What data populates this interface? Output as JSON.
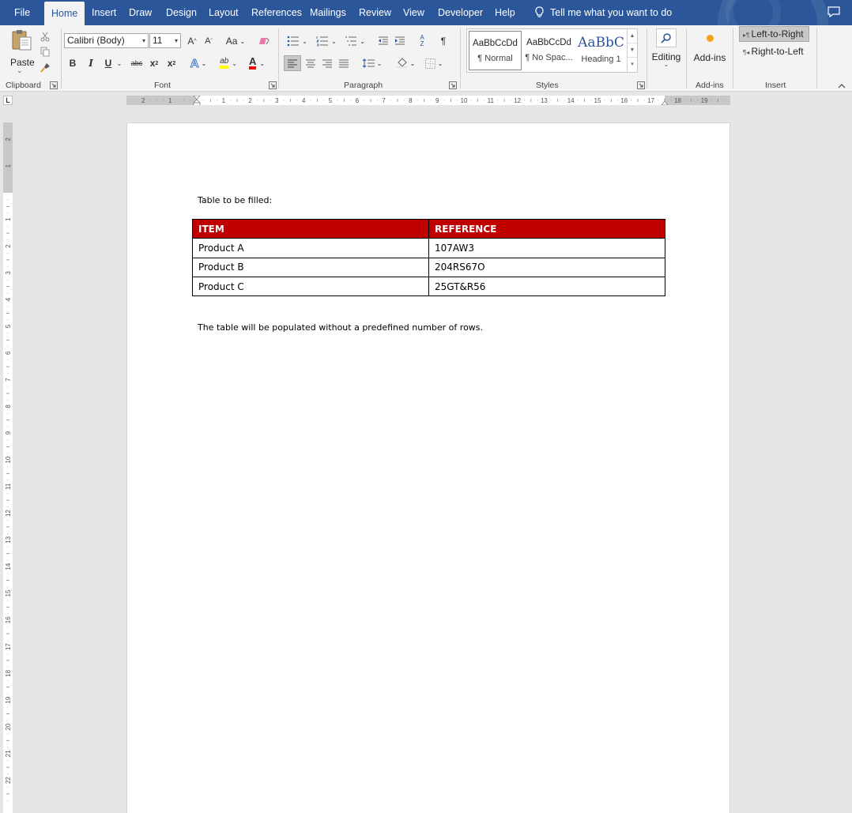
{
  "tabs": [
    {
      "label": "File",
      "active": false
    },
    {
      "label": "Home",
      "active": true
    },
    {
      "label": "Insert",
      "active": false
    },
    {
      "label": "Draw",
      "active": false
    },
    {
      "label": "Design",
      "active": false
    },
    {
      "label": "Layout",
      "active": false
    },
    {
      "label": "References",
      "active": false
    },
    {
      "label": "Mailings",
      "active": false
    },
    {
      "label": "Review",
      "active": false
    },
    {
      "label": "View",
      "active": false
    },
    {
      "label": "Developer",
      "active": false
    },
    {
      "label": "Help",
      "active": false
    }
  ],
  "tell_me": "Tell me what you want to do",
  "ribbon": {
    "clipboard": {
      "paste_label": "Paste",
      "group_label": "Clipboard"
    },
    "font": {
      "font_name": "Calibri (Body)",
      "font_size": "11",
      "change_case": "Aa",
      "group_label": "Font",
      "bold": "B",
      "italic": "I",
      "underline": "U",
      "strike": "abc",
      "subscript": "x",
      "superscript": "x",
      "grow": "A",
      "shrink": "A",
      "font_color": "A",
      "highlight": "ab"
    },
    "paragraph": {
      "group_label": "Paragraph",
      "sort": "A Z",
      "pilcrow": "¶"
    },
    "styles": {
      "group_label": "Styles",
      "items": [
        {
          "preview": "AaBbCcDd",
          "name": "¶ Normal",
          "selected": true
        },
        {
          "preview": "AaBbCcDd",
          "name": "¶ No Spac...",
          "selected": false
        },
        {
          "preview": "AaBbC",
          "name": "Heading 1",
          "selected": false
        }
      ]
    },
    "editing": {
      "label": "Editing"
    },
    "addins": {
      "label": "Add-ins",
      "group_label": "Add-ins"
    },
    "insert": {
      "ltr_label": "Left-to-Right",
      "rtl_label": "Right-to-Left",
      "group_label": "Insert"
    }
  },
  "rulers": {
    "corner": "L",
    "horizontal_labels": [
      "2",
      "1",
      "1",
      "2",
      "3",
      "4",
      "5",
      "6",
      "7",
      "8",
      "9",
      "10",
      "11",
      "12",
      "13",
      "14",
      "15",
      "16",
      "17",
      "18",
      "19"
    ],
    "vertical_labels": [
      "2",
      "1",
      "1",
      "2",
      "3",
      "4",
      "5",
      "6",
      "7",
      "8",
      "9",
      "10",
      "11",
      "12",
      "13",
      "14",
      "15",
      "16",
      "17",
      "18",
      "19",
      "20",
      "21",
      "22"
    ]
  },
  "document": {
    "intro": "Table to be filled:",
    "table": {
      "headers": [
        "ITEM",
        "REFERENCE"
      ],
      "rows": [
        [
          "Product A",
          "107AW3"
        ],
        [
          "Product B",
          "204RS67O"
        ],
        [
          "Product C",
          "25GT&R56"
        ]
      ]
    },
    "note": "The table will be populated without a predefined number of rows."
  },
  "colors": {
    "title_bar": "#2b579a",
    "table_header": "#c00000",
    "ribbon_bg": "#f3f3f3",
    "canvas_bg": "#e6e6e6",
    "heading_style": "#2f5496"
  }
}
